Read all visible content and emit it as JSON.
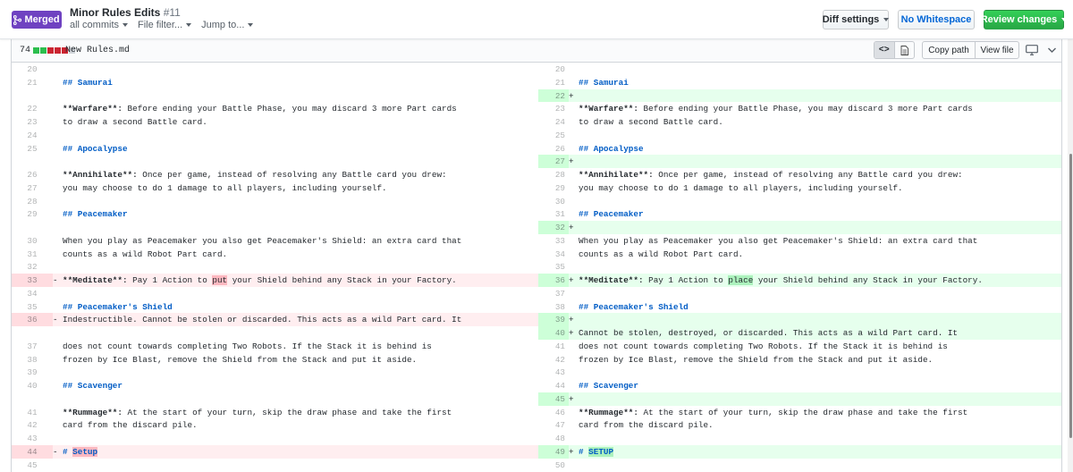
{
  "header": {
    "status_badge": "Merged",
    "title": "Minor Rules Edits",
    "pr_number": "#11",
    "commits_menu": "all commits",
    "file_filter_menu": "File filter...",
    "jump_menu": "Jump to...",
    "diff_settings_label": "Diff settings",
    "no_whitespace_label": "No Whitespace",
    "review_changes_label": "Review changes",
    "colors": {
      "merged": "#6f42c1",
      "review": "#2ea44f",
      "link": "#0366d6"
    }
  },
  "file": {
    "changes": "74",
    "name": "New Rules.md",
    "copy_path_label": "Copy path",
    "view_file_label": "View file",
    "source_view_icon": "<>",
    "icons": [
      "code-icon",
      "file-icon",
      "monitor-icon",
      "chevron-down-icon"
    ],
    "diffstat": [
      "add",
      "add",
      "del",
      "del",
      "del",
      "neutral"
    ]
  },
  "diff_rows": [
    {
      "h": 1,
      "l": {
        "n": "20",
        "t": "",
        "k": ""
      },
      "r": {
        "n": "20",
        "t": "",
        "k": ""
      }
    },
    {
      "h": 1,
      "l": {
        "n": "21",
        "t": "## Samurai",
        "k": "",
        "s": "hd"
      },
      "r": {
        "n": "21",
        "t": "## Samurai",
        "k": "",
        "s": "hd"
      }
    },
    {
      "h": 1,
      "l": {
        "n": "",
        "t": "",
        "k": "empty"
      },
      "r": {
        "n": "22",
        "t": "",
        "k": "add",
        "m": "+"
      }
    },
    {
      "h": 1,
      "l": {
        "n": "22",
        "t": "Before ending your Battle Phase, you may discard 3 more Part cards",
        "k": "",
        "bold": "**Warfare**:"
      },
      "r": {
        "n": "23",
        "t": "Before ending your Battle Phase, you may discard 3 more Part cards",
        "k": "",
        "bold": "**Warfare**:"
      }
    },
    {
      "h": 1,
      "l": {
        "n": "23",
        "t": "to draw a second Battle card.",
        "k": ""
      },
      "r": {
        "n": "24",
        "t": "to draw a second Battle card.",
        "k": ""
      }
    },
    {
      "h": 1,
      "l": {
        "n": "24",
        "t": "",
        "k": ""
      },
      "r": {
        "n": "25",
        "t": "",
        "k": ""
      }
    },
    {
      "h": 1,
      "l": {
        "n": "25",
        "t": "## Apocalypse",
        "k": "",
        "s": "hd"
      },
      "r": {
        "n": "26",
        "t": "## Apocalypse",
        "k": "",
        "s": "hd"
      }
    },
    {
      "h": 1,
      "l": {
        "n": "",
        "t": "",
        "k": "empty"
      },
      "r": {
        "n": "27",
        "t": "",
        "k": "add",
        "m": "+"
      }
    },
    {
      "h": 1,
      "l": {
        "n": "26",
        "t": "Once per game, instead of resolving any Battle card you drew:",
        "k": "",
        "bold": "**Annihilate**:"
      },
      "r": {
        "n": "28",
        "t": "Once per game, instead of resolving any Battle card you drew:",
        "k": "",
        "bold": "**Annihilate**:"
      }
    },
    {
      "h": 1,
      "l": {
        "n": "27",
        "t": "you may choose to do 1 damage to all players, including yourself.",
        "k": ""
      },
      "r": {
        "n": "29",
        "t": "you may choose to do 1 damage to all players, including yourself.",
        "k": ""
      }
    },
    {
      "h": 1,
      "l": {
        "n": "28",
        "t": "",
        "k": ""
      },
      "r": {
        "n": "30",
        "t": "",
        "k": ""
      }
    },
    {
      "h": 1,
      "l": {
        "n": "29",
        "t": "## Peacemaker",
        "k": "",
        "s": "hd"
      },
      "r": {
        "n": "31",
        "t": "## Peacemaker",
        "k": "",
        "s": "hd"
      }
    },
    {
      "h": 1,
      "l": {
        "n": "",
        "t": "",
        "k": "empty"
      },
      "r": {
        "n": "32",
        "t": "",
        "k": "add",
        "m": "+"
      }
    },
    {
      "h": 1,
      "l": {
        "n": "30",
        "t": "When you play as Peacemaker you also get Peacemaker's Shield: an extra card that",
        "k": ""
      },
      "r": {
        "n": "33",
        "t": "When you play as Peacemaker you also get Peacemaker's Shield: an extra card that",
        "k": ""
      }
    },
    {
      "h": 1,
      "l": {
        "n": "31",
        "t": "counts as a wild Robot Part card.",
        "k": ""
      },
      "r": {
        "n": "34",
        "t": "counts as a wild Robot Part card.",
        "k": ""
      }
    },
    {
      "h": 1,
      "l": {
        "n": "32",
        "t": "",
        "k": ""
      },
      "r": {
        "n": "35",
        "t": "",
        "k": ""
      }
    },
    {
      "h": 1,
      "l": {
        "n": "33",
        "t": "",
        "k": "del",
        "m": "-",
        "bold": "**Meditate**:",
        "pre": " Pay 1 Action to ",
        "hl": "put",
        "post": " your Shield behind any Stack in your Factory."
      },
      "r": {
        "n": "36",
        "t": "",
        "k": "add",
        "m": "+",
        "bold": "**Meditate**:",
        "pre": " Pay 1 Action to ",
        "hl": "place",
        "post": " your Shield behind any Stack in your Factory."
      }
    },
    {
      "h": 1,
      "l": {
        "n": "34",
        "t": "",
        "k": ""
      },
      "r": {
        "n": "37",
        "t": "",
        "k": ""
      }
    },
    {
      "h": 1,
      "l": {
        "n": "35",
        "t": "## Peacemaker's Shield",
        "k": "",
        "s": "hd"
      },
      "r": {
        "n": "38",
        "t": "## Peacemaker's Shield",
        "k": "",
        "s": "hd"
      }
    },
    {
      "h": 1,
      "l": {
        "n": "36",
        "t": "Indestructible. Cannot be stolen or discarded. This acts as a wild Part card. It",
        "k": "del",
        "m": "-"
      },
      "r": {
        "n": "39",
        "t": "",
        "k": "add",
        "m": "+"
      }
    },
    {
      "h": 1,
      "l": {
        "n": "",
        "t": "",
        "k": "empty"
      },
      "r": {
        "n": "40",
        "t": "Cannot be stolen, destroyed, or discarded. This acts as a wild Part card. It",
        "k": "add",
        "m": "+"
      }
    },
    {
      "h": 1,
      "l": {
        "n": "37",
        "t": "does not count towards completing Two Robots. If the Stack it is behind is",
        "k": ""
      },
      "r": {
        "n": "41",
        "t": "does not count towards completing Two Robots. If the Stack it is behind is",
        "k": ""
      }
    },
    {
      "h": 1,
      "l": {
        "n": "38",
        "t": "frozen by Ice Blast, remove the Shield from the Stack and put it aside.",
        "k": ""
      },
      "r": {
        "n": "42",
        "t": "frozen by Ice Blast, remove the Shield from the Stack and put it aside.",
        "k": ""
      }
    },
    {
      "h": 1,
      "l": {
        "n": "39",
        "t": "",
        "k": ""
      },
      "r": {
        "n": "43",
        "t": "",
        "k": ""
      }
    },
    {
      "h": 1,
      "l": {
        "n": "40",
        "t": "## Scavenger",
        "k": "",
        "s": "hd"
      },
      "r": {
        "n": "44",
        "t": "## Scavenger",
        "k": "",
        "s": "hd"
      }
    },
    {
      "h": 1,
      "l": {
        "n": "",
        "t": "",
        "k": "empty"
      },
      "r": {
        "n": "45",
        "t": "",
        "k": "add",
        "m": "+"
      }
    },
    {
      "h": 1,
      "l": {
        "n": "41",
        "t": "At the start of your turn, skip the draw phase and take the first",
        "k": "",
        "bold": "**Rummage**:"
      },
      "r": {
        "n": "46",
        "t": "At the start of your turn, skip the draw phase and take the first",
        "k": "",
        "bold": "**Rummage**:"
      }
    },
    {
      "h": 1,
      "l": {
        "n": "42",
        "t": "card from the discard pile.",
        "k": ""
      },
      "r": {
        "n": "47",
        "t": "card from the discard pile.",
        "k": ""
      }
    },
    {
      "h": 1,
      "l": {
        "n": "43",
        "t": "",
        "k": ""
      },
      "r": {
        "n": "48",
        "t": "",
        "k": ""
      }
    },
    {
      "h": 1,
      "l": {
        "n": "44",
        "t": "",
        "k": "del",
        "m": "-",
        "pre": "# ",
        "hl": "Setup",
        "post": "",
        "s": "hd"
      },
      "r": {
        "n": "49",
        "t": "",
        "k": "add",
        "m": "+",
        "pre": "# ",
        "hl": "SETUP",
        "post": "",
        "s": "hd"
      }
    },
    {
      "h": 1,
      "l": {
        "n": "45",
        "t": "",
        "k": ""
      },
      "r": {
        "n": "50",
        "t": "",
        "k": ""
      }
    }
  ]
}
